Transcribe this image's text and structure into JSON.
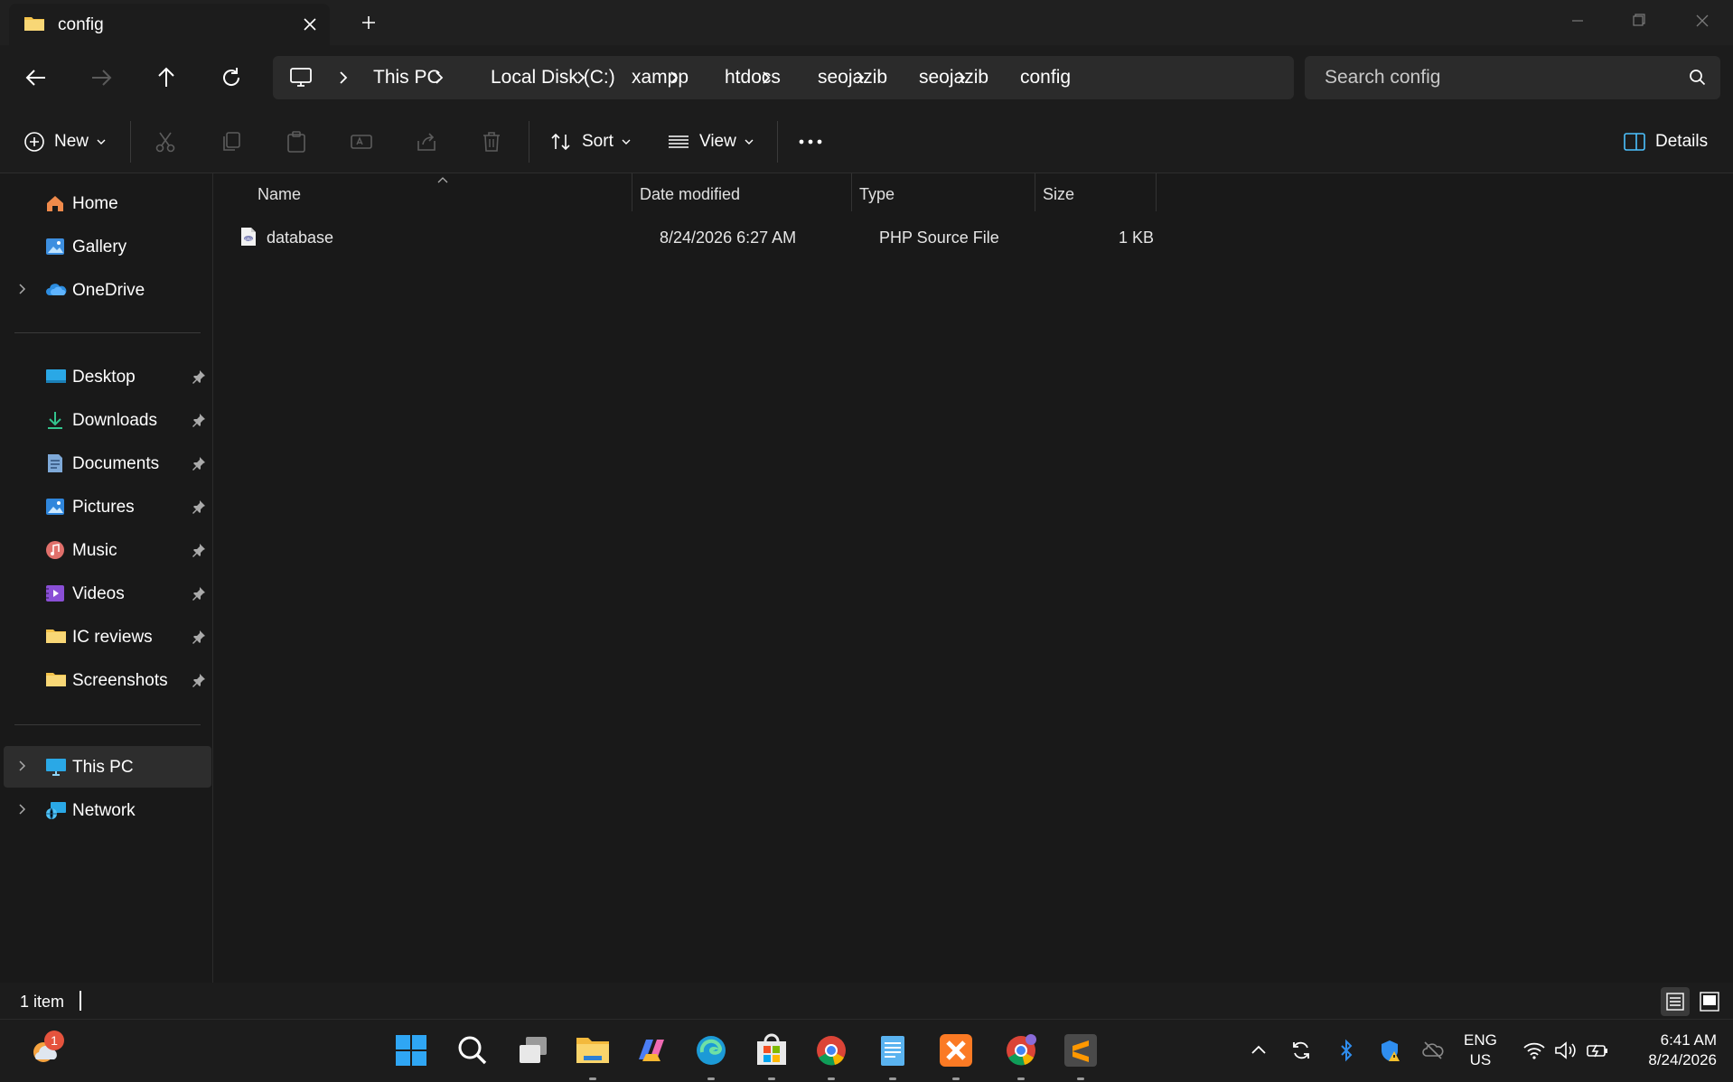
{
  "window": {
    "tab_title": "config"
  },
  "address": {
    "crumbs": [
      "This PC",
      "Local Disk (C:)",
      "xampp",
      "htdocs",
      "seojazib",
      "seojazib",
      "config"
    ],
    "search_placeholder": "Search config"
  },
  "toolbar": {
    "new_label": "New",
    "sort_label": "Sort",
    "view_label": "View",
    "details_label": "Details"
  },
  "sidebar": {
    "quick": [
      {
        "label": "Home",
        "icon": "home-icon"
      },
      {
        "label": "Gallery",
        "icon": "gallery-icon"
      },
      {
        "label": "OneDrive",
        "icon": "onedrive-icon"
      }
    ],
    "pinned": [
      {
        "label": "Desktop",
        "icon": "desktop-icon"
      },
      {
        "label": "Downloads",
        "icon": "downloads-icon"
      },
      {
        "label": "Documents",
        "icon": "documents-icon"
      },
      {
        "label": "Pictures",
        "icon": "pictures-icon"
      },
      {
        "label": "Music",
        "icon": "music-icon"
      },
      {
        "label": "Videos",
        "icon": "videos-icon"
      },
      {
        "label": "IC reviews",
        "icon": "folder-icon"
      },
      {
        "label": "Screenshots",
        "icon": "folder-icon"
      }
    ],
    "drives": [
      {
        "label": "This PC",
        "icon": "this-pc-icon"
      },
      {
        "label": "Network",
        "icon": "network-icon"
      }
    ]
  },
  "files": {
    "columns": {
      "name": "Name",
      "date": "Date modified",
      "type": "Type",
      "size": "Size"
    },
    "rows": [
      {
        "name": "database",
        "date": "8/24/2026 6:27 AM",
        "type": "PHP Source File",
        "size": "1 KB"
      }
    ]
  },
  "status": {
    "count": "1 item"
  },
  "taskbar": {
    "notification_badge": "1",
    "lang_top": "ENG",
    "lang_bottom": "US",
    "time": "6:41 AM",
    "date": "8/24/2026"
  },
  "colors": {
    "folder": "#f3c24a",
    "accent": "#4cc2ff",
    "selection": "#2d2d2d"
  }
}
